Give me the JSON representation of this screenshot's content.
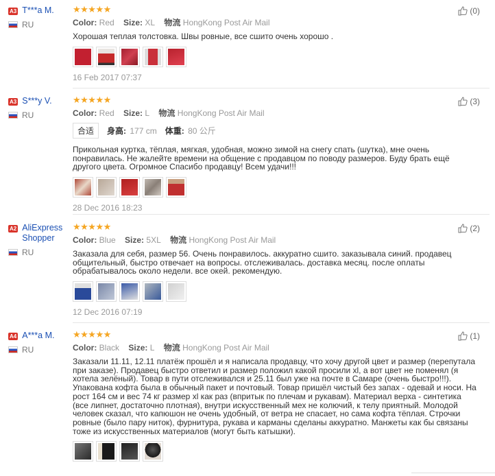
{
  "reviews": [
    {
      "level": "A3",
      "name": "T***a M.",
      "country": "RU",
      "stars": "★★★★★",
      "color_label": "Color:",
      "color": "Red",
      "size_label": "Size:",
      "size": "XL",
      "shipping_label": "物流",
      "shipping": "HongKong Post Air Mail",
      "text": "Хорошая теплая толстовка. Швы ровные, все сшито очень хорошо .",
      "thumbs": [
        "#c22030",
        "#c52a2a",
        "#a52030",
        "#c9303a",
        "#b8222e"
      ],
      "date": "16 Feb 2017 07:37",
      "likes": "(0)"
    },
    {
      "level": "A3",
      "name": "S***y V.",
      "country": "RU",
      "stars": "★★★★★",
      "color_label": "Color:",
      "color": "Red",
      "size_label": "Size:",
      "size": "L",
      "shipping_label": "物流",
      "shipping": "HongKong Post Air Mail",
      "fit": {
        "tag": "合适",
        "height_label": "身高:",
        "height": "177 cm",
        "weight_label": "体重:",
        "weight": "80 公斤"
      },
      "text": "Прикольная куртка, тёплая, мягкая, удобная, можно зимой на снегу спать (шутка), мне очень понравилась. Не жалейте времени на общение с продавцом по поводу размеров. Буду брать ещё другого цвета. Огромное Спасибо продавцу! Всем удачи!!!",
      "thumbs": [
        "#b04a3a",
        "#b8a898",
        "#b02020",
        "#c0b8b0",
        "#c03030"
      ],
      "date": "28 Dec 2016 18:23",
      "likes": "(3)"
    },
    {
      "level": "A2",
      "name": "AliExpress Shopper",
      "country": "RU",
      "stars": "★★★★★",
      "color_label": "Color:",
      "color": "Blue",
      "size_label": "Size:",
      "size": "5XL",
      "shipping_label": "物流",
      "shipping": "HongKong Post Air Mail",
      "text": "Заказала для себя, размер 56. Очень понравилось. аккуратно сшито. заказывала синий. продавец общительный, быстро отвечает на вопросы. отслеживалась. доставка месяц. после оплаты обрабатывалось около недели. все окей. рекомендую.",
      "thumbs": [
        "#2a4a9a",
        "#7a88a8",
        "#3a5aa8",
        "#b0b8c0",
        "#d0d0d0"
      ],
      "date": "12 Dec 2016 07:19",
      "likes": "(2)"
    },
    {
      "level": "A4",
      "name": "A***a M.",
      "country": "RU",
      "stars": "★★★★★",
      "color_label": "Color:",
      "color": "Black",
      "size_label": "Size:",
      "size": "L",
      "shipping_label": "物流",
      "shipping": "HongKong Post Air Mail",
      "text": "Заказали 11.11, 12.11 платёж прошёл и я написала продавцу, что хочу другой цвет и размер (перепутала при заказе). Продавец быстро ответил и размер положил какой просили xl, а вот цвет не поменял (я хотела зелёный). Товар в пути отслеживался и 25.11 был уже на почте в Самаре (очень быстро!!!). Упакована кофта была в обычный пакет и почтовый. Товар пришёл чистый без запах - одевай и носи. На рост 164 см и вес 74 кг размер xl как раз (впритык по плечам и рукавам). Материал верха - синтетика (все липнет, достаточно плотная), внутри искусственный мех не колючий, к телу приятный. Молодой человек сказал, что капюшон не очень удобный, от ветра не спасает, но сама кофта тёплая. Строчки ровные (было пару ниток), фурнитура, рукава и карманы сделаны аккуратно. Манжеты как бы связаны тоже из искусственных материалов (могут быть катышки).",
      "thumbs": [
        "#2a2a2a",
        "#1a1a1a",
        "#222222",
        "#3a3a3a"
      ],
      "date": "",
      "likes": "(1)"
    }
  ]
}
